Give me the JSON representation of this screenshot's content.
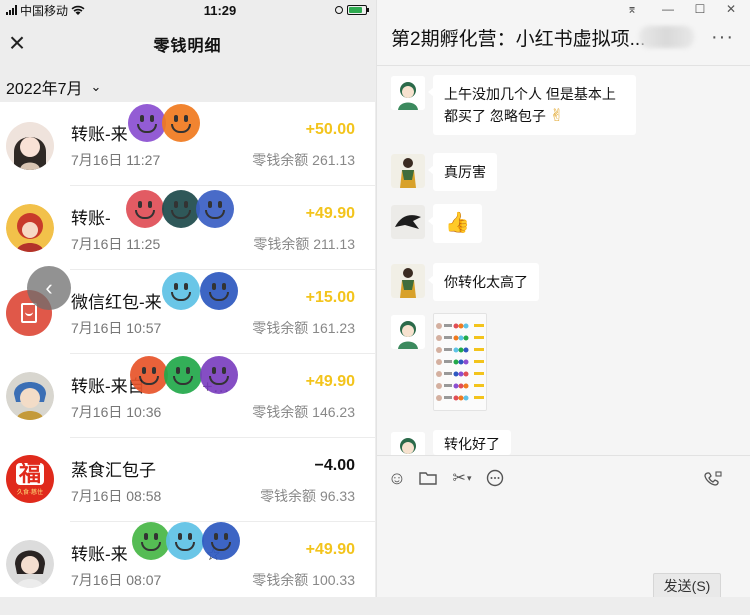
{
  "status_bar": {
    "carrier": "中国移动",
    "time": "11:29",
    "battery_level": 0.8
  },
  "nav": {
    "title": "零钱明细",
    "close_icon": "close-icon"
  },
  "month": {
    "label": "2022年7月",
    "chevron": "⌄"
  },
  "transactions": [
    {
      "title": "转账-来",
      "date": "7月16日 11:27",
      "amount": "+50.00",
      "balance": "零钱余额 261.13"
    },
    {
      "title": "转账-来",
      "date": "7月16日 11:25",
      "amount": "+49.90",
      "balance": "零钱余额 211.13"
    },
    {
      "title": "微信红包-来",
      "date": "7月16日 10:57",
      "amount": "+15.00",
      "balance": "零钱余额 161.23"
    },
    {
      "title": "转账-来自",
      "title_suffix": "+…",
      "date": "7月16日 10:36",
      "amount": "+49.90",
      "balance": "零钱余额 146.23"
    },
    {
      "title": "蒸食汇包子",
      "date": "7月16日 08:58",
      "amount": "−4.00",
      "balance": "零钱余额 96.33",
      "logo_char": "福",
      "logo_sub": "久食·慈住"
    },
    {
      "title": "转账-来",
      "title_suffix": "☆",
      "date": "7月16日 08:07",
      "amount": "+49.90",
      "balance": "零钱余额 100.33"
    }
  ],
  "chat": {
    "title": "第2期孵化营：小红书虚拟项...",
    "more": "···",
    "window_controls": {
      "pin": "⌆",
      "minimize": "—",
      "maximize": "☐",
      "close": "✕"
    },
    "messages": [
      {
        "text_line1": "上午没加几个人 但是基本上",
        "text_line2": "都买了 忽略包子",
        "emoji": "✌"
      },
      {
        "text": "真厉害"
      },
      {
        "emoji": "👍"
      },
      {
        "text": "你转化太高了"
      },
      {
        "image": "screenshot-thumbnail"
      },
      {
        "text": "转化好了"
      }
    ],
    "toolbar": {
      "emoji": "☺",
      "folder": "▭",
      "scissors": "✂",
      "scissors_caret": "▾",
      "bubble": "◌",
      "video": "☏"
    },
    "send_label": "发送(S)"
  },
  "colors": {
    "income": "#f3c41c",
    "expense": "#111111",
    "red_packet": "#e05849"
  }
}
